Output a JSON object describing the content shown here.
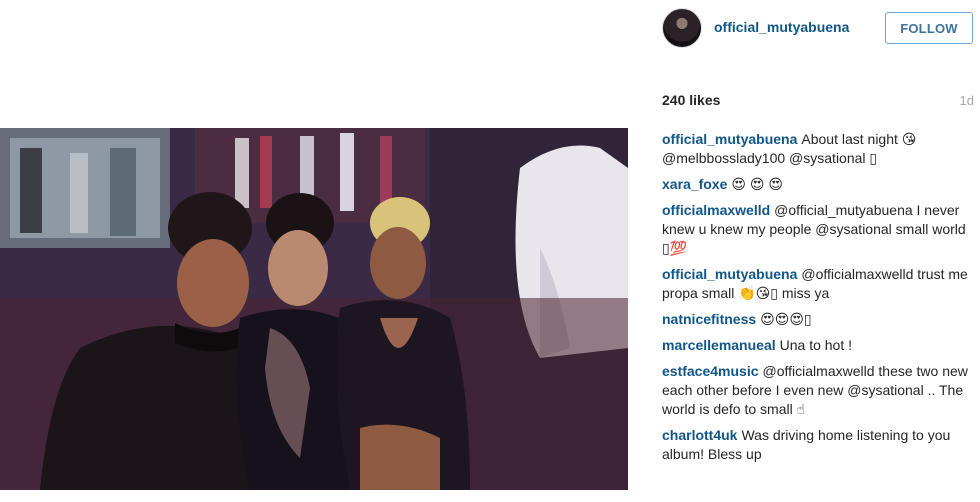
{
  "post": {
    "image_alt_description_visible": "",
    "author": "official_mutyabuena",
    "follow_label": "FOLLOW",
    "likes": "240 likes",
    "time_ago": "1d"
  },
  "colors": {
    "link_blue": "#125688",
    "follow_border": "#6fa8d8",
    "follow_text": "#3f729b",
    "muted": "#a5a7aa"
  },
  "comments": [
    {
      "author": "official_mutyabuena",
      "text": "About last night 😘 @melbbosslady100 @sysational ▯"
    },
    {
      "author": "xara_foxe",
      "text": "😍 😍 😍"
    },
    {
      "author": "officialmaxwelld",
      "text": "@official_mutyabuena I never knew u knew my people @sysational small world ▯💯"
    },
    {
      "author": "official_mutyabuena",
      "text": "@officialmaxwelld trust me propa small 👏😘▯ miss ya"
    },
    {
      "author": "natnicefitness",
      "text": "😍😍😍▯"
    },
    {
      "author": "marcellemanueal",
      "text": "Una to hot !"
    },
    {
      "author": "estface4music",
      "text": "@officialmaxwelld these two new each other before I even new @sysational .. The world is defo to small ☝"
    },
    {
      "author": "charlott4uk",
      "text": "Was driving home listening to you album! Bless up"
    }
  ]
}
